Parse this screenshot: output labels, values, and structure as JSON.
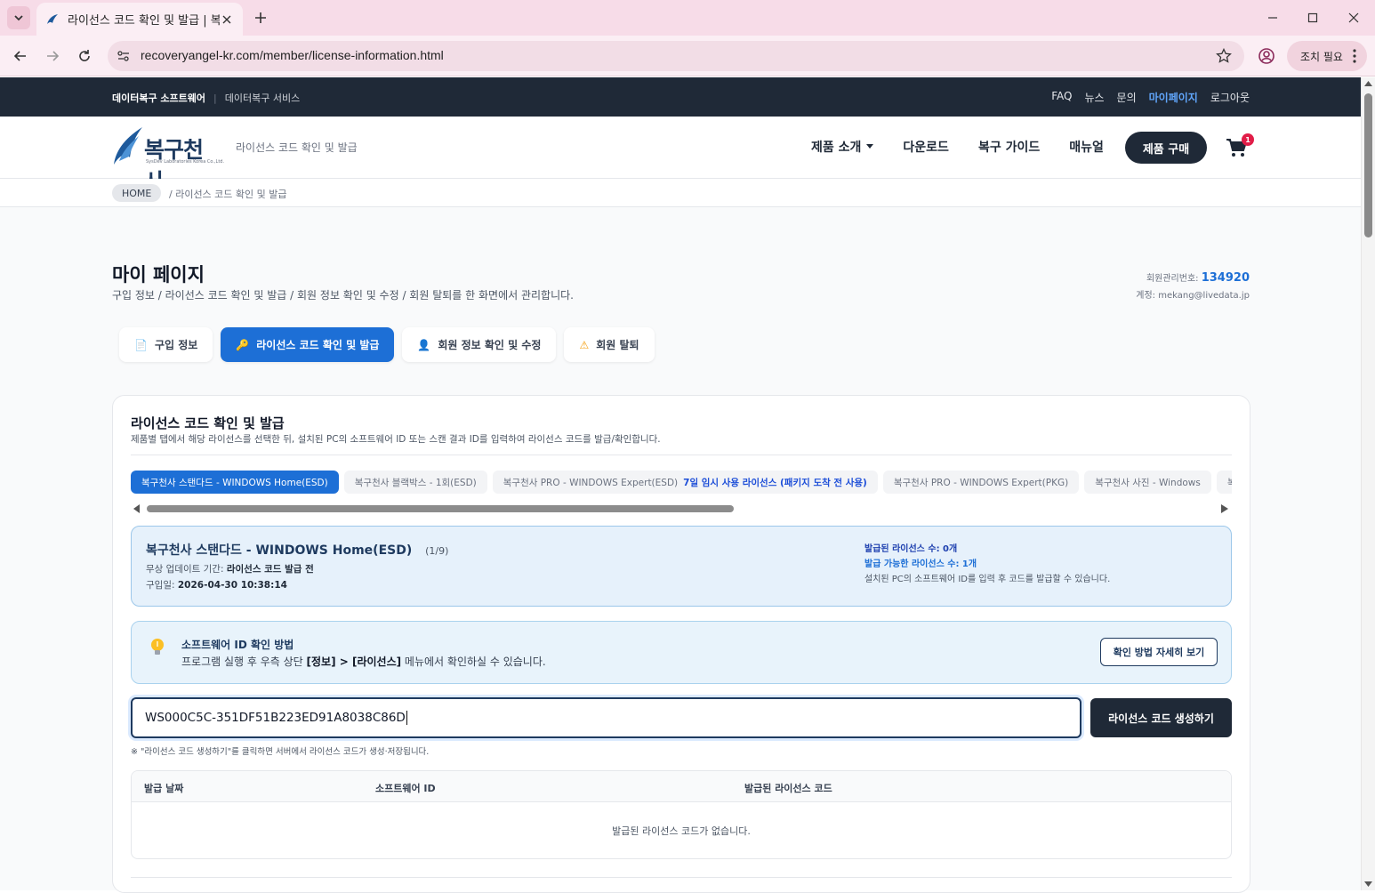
{
  "browser": {
    "tab_title": "라이선스 코드 확인 및 발급 | 복구천사",
    "url": "recoveryangel-kr.com/member/license-information.html",
    "action_pill": "조치 필요"
  },
  "site_bar": {
    "left_primary": "데이터복구 소프트웨어",
    "left_secondary": "데이터복구 서비스",
    "links": [
      "FAQ",
      "뉴스",
      "문의",
      "마이페이지",
      "로그아웃"
    ],
    "active_link": "마이페이지"
  },
  "header": {
    "logo_text": "복구천사",
    "logo_sub": "SysDev Laboratories Korea Co.,Ltd.",
    "subtitle": "라이선스 코드 확인 및 발급",
    "nav": [
      "제품 소개",
      "다운로드",
      "복구 가이드",
      "매뉴얼"
    ],
    "buy_label": "제품 구매",
    "cart_count": "1"
  },
  "breadcrumb": {
    "home": "HOME",
    "current": "/  라이선스 코드 확인 및 발급"
  },
  "page": {
    "title": "마이 페이지",
    "description": "구입 정보 / 라이선스 코드 확인 및 발급 / 회원 정보 확인 및 수정 / 회원 탈퇴를 한 화면에서 관리합니다.",
    "member_label": "회원관리번호:",
    "member_no": "134920",
    "account": "계정: mekang@livedata.jp"
  },
  "tabs": [
    {
      "icon": "document-icon",
      "glyph": "📄",
      "label": "구입 정보"
    },
    {
      "icon": "key-icon",
      "glyph": "🔑",
      "label": "라이선스 코드 확인 및 발급",
      "active": true
    },
    {
      "icon": "user-icon",
      "glyph": "👤",
      "label": "회원 정보 확인 및 수정"
    },
    {
      "icon": "warning-icon",
      "glyph": "⚠",
      "label": "회원 탈퇴"
    }
  ],
  "license_card": {
    "title": "라이선스 코드 확인 및 발급",
    "description": "제품별 탭에서 해당 라이선스를 선택한 뒤, 설치된 PC의 소프트웨어 ID 또는 스캔 결과 ID를 입력하여 라이선스 코드를 발급/확인합니다.",
    "products": [
      {
        "label": "복구천사 스탠다드 - WINDOWS Home(ESD)",
        "active": true
      },
      {
        "label": "복구천사 블랙박스 - 1회(ESD)"
      },
      {
        "label": "복구천사 PRO - WINDOWS Expert(ESD)",
        "highlight": "7일 임시 사용 라이선스 (패키지 도착 전 사용)"
      },
      {
        "label": "복구천사 PRO - WINDOWS Expert(PKG)"
      },
      {
        "label": "복구천사 사진 - Windows"
      },
      {
        "label": "복구천사 PRO - WINDOWS Expert"
      }
    ],
    "product_scroll_fraction": 0.55,
    "selected": {
      "name": "복구천사 스탠다드 - WINDOWS Home(ESD)",
      "count": "(1/9)",
      "update_label": "무상 업데이트 기간:",
      "update_value": "라이선스 코드 발급 전",
      "purchase_label": "구입일:",
      "purchase_value": "2026-04-30 10:38:14",
      "issued": "발급된 라이선스 수: 0개",
      "available": "발급 가능한 라이선스 수: 1개",
      "hint": "설치된 PC의 소프트웨어 ID를 입력 후 코드를 발급할 수 있습니다."
    },
    "tip": {
      "title": "소프트웨어 ID 확인 방법",
      "text_before": "프로그램 실행 후 우측 상단 ",
      "text_bold": "[정보] > [라이선스]",
      "text_after": " 메뉴에서 확인하실 수 있습니다.",
      "button": "확인 방법 자세히 보기"
    },
    "software_id_value": "WS000C5C-351DF51B223ED91A8038C86D",
    "generate_label": "라이선스 코드 생성하기",
    "note": "※ \"라이선스 코드 생성하기\"를 클릭하면 서버에서 라이선스 코드가 생성·저장됩니다.",
    "table": {
      "headers": [
        "발급 날짜",
        "소프트웨어 ID",
        "발급된 라이선스 코드"
      ],
      "empty": "발급된 라이선스 코드가 없습니다."
    }
  },
  "colors": {
    "accent": "#1d6fd6",
    "dark": "#1f2937",
    "browser_tint": "#f7dce8"
  }
}
